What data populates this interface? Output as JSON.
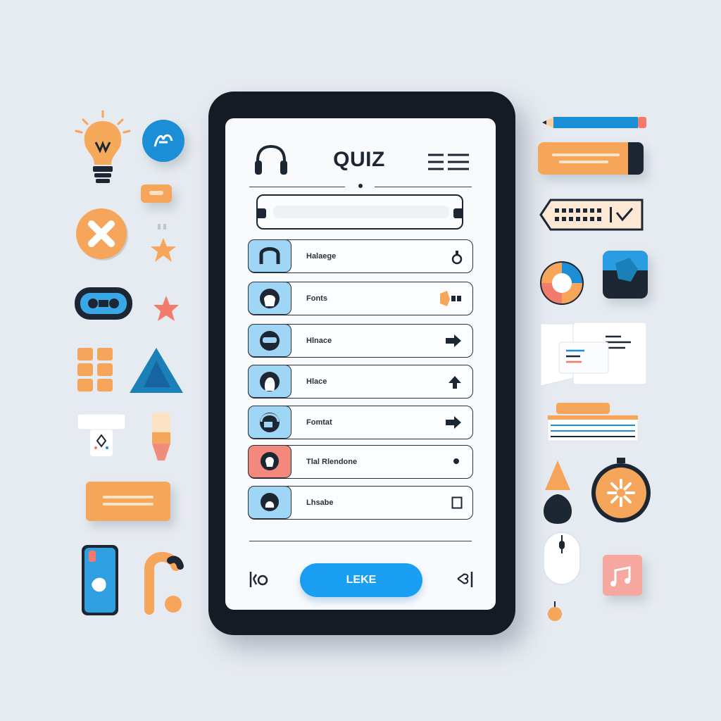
{
  "header": {
    "title": "QUIZ"
  },
  "search": {
    "value": "",
    "placeholder": ""
  },
  "list": [
    {
      "label": "Halaege",
      "tile": "blue",
      "trail": "lock-icon"
    },
    {
      "label": "Fonts",
      "tile": "blue",
      "trail": "speaker-icon"
    },
    {
      "label": "Hlnace",
      "tile": "blue",
      "trail": "arrow-right-icon"
    },
    {
      "label": "Hlace",
      "tile": "blue",
      "trail": "arrow-up-icon"
    },
    {
      "label": "Fomtat",
      "tile": "blue",
      "trail": "arrow-right-icon"
    },
    {
      "label": "Tlal Rlendone",
      "tile": "red",
      "trail": "dot-icon"
    },
    {
      "label": "Lhsabe",
      "tile": "blue",
      "trail": "checkbox-icon"
    }
  ],
  "footer": {
    "button_label": "LEKE"
  },
  "colors": {
    "accent": "#1a9ef1",
    "orange": "#f6a65a",
    "navy": "#141b24",
    "tile_blue": "#9fd5f5",
    "tile_red": "#f3897c"
  }
}
